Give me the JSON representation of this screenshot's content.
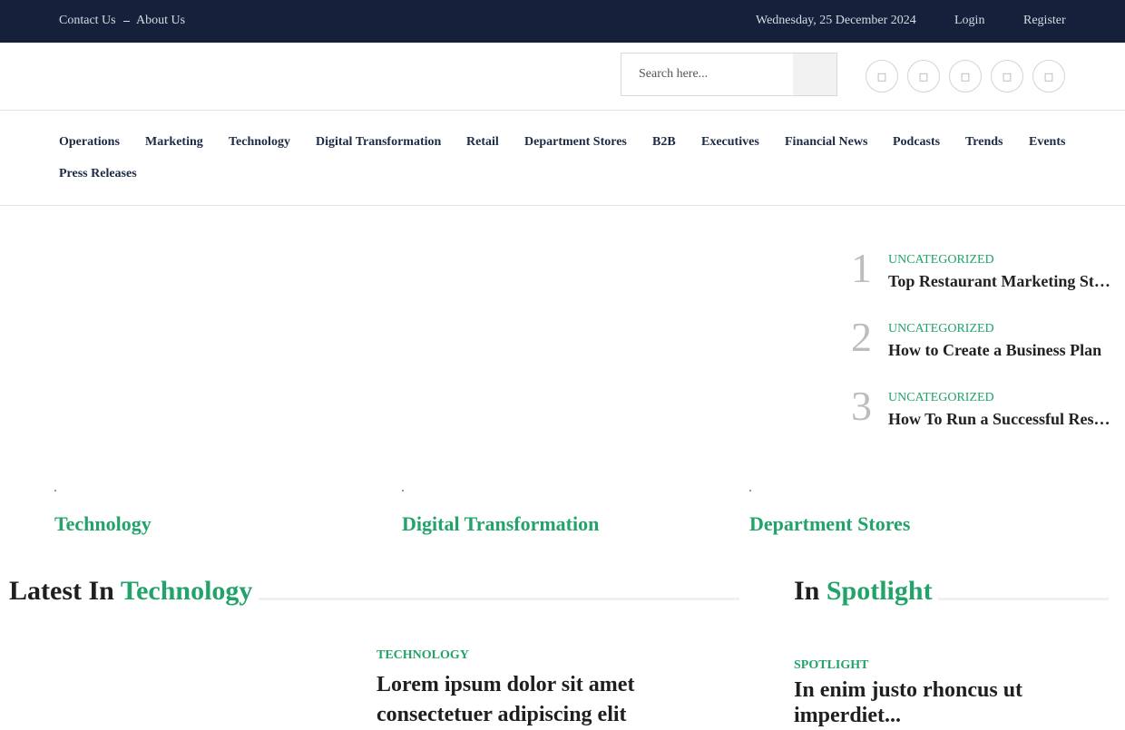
{
  "topbar": {
    "contact_label": "Contact Us",
    "about_label": "About Us",
    "date": "Wednesday, 25 December 2024",
    "login_label": "Login",
    "register_label": "Register"
  },
  "search": {
    "placeholder": "Search here..."
  },
  "social_icons": [
    "facebook-icon",
    "twitter-icon",
    "instagram-icon",
    "linkedin-icon",
    "youtube-icon"
  ],
  "nav": {
    "items": [
      "Operations",
      "Marketing",
      "Technology",
      "Digital Transformation",
      "Retail",
      "Department Stores",
      "B2B",
      "Executives",
      "Financial News",
      "Podcasts",
      "Trends",
      "Events",
      "Press Releases"
    ]
  },
  "trending": [
    {
      "number": "1",
      "category": "UNCATEGORIZED",
      "title": "Top Restaurant Marketing Strategies"
    },
    {
      "number": "2",
      "category": "UNCATEGORIZED",
      "title": "How to Create a Business Plan"
    },
    {
      "number": "3",
      "category": "UNCATEGORIZED",
      "title": "How To Run a Successful Restaurant"
    }
  ],
  "category_cards": [
    "Technology",
    "Digital Transformation",
    "Department Stores"
  ],
  "latest": {
    "prefix": "Latest In",
    "highlight": "Technology",
    "post": {
      "category": "TECHNOLOGY",
      "title": "Lorem ipsum dolor sit amet consectetuer adipiscing elit"
    }
  },
  "spotlight": {
    "prefix": "In",
    "highlight": "Spotlight",
    "post": {
      "category": "SPOTLIGHT",
      "title": "In enim justo rhoncus ut imperdiet..."
    }
  },
  "colors": {
    "topbar_bg": "#15213a",
    "accent": "#22a36a",
    "nav_text": "#1c2a44"
  }
}
